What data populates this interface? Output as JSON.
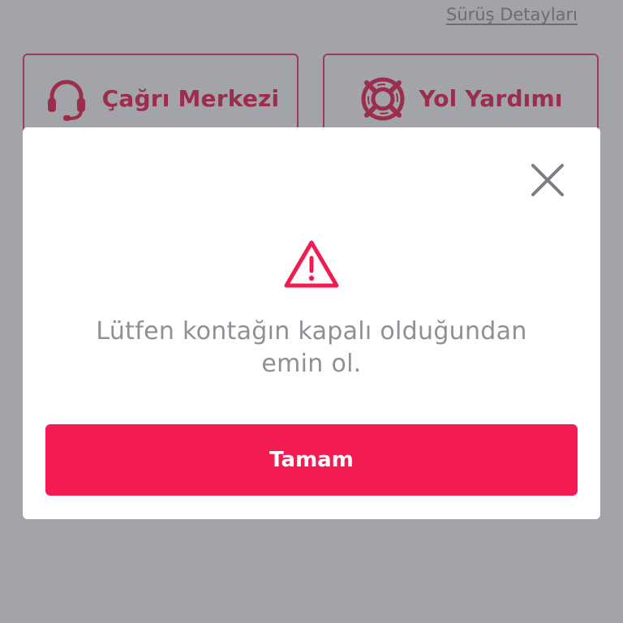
{
  "header": {
    "details_link": "Sürüş Detayları"
  },
  "actions": {
    "call_center": {
      "label": "Çağrı Merkezi",
      "icon": "headset-icon"
    },
    "roadside": {
      "label": "Yol Yardımı",
      "icon": "lifebuoy-icon"
    }
  },
  "dialog": {
    "close_icon": "close-icon",
    "warning_icon": "warning-icon",
    "message_line1": "Lütfen kontağın kapalı olduğundan",
    "message_line2": "emin ol.",
    "ok_label": "Tamam"
  },
  "colors": {
    "overlay": "#a2a4aa",
    "accent": "#f21c53",
    "accent_dimmed": "#9a2e4c",
    "message_text": "#8f9095"
  }
}
